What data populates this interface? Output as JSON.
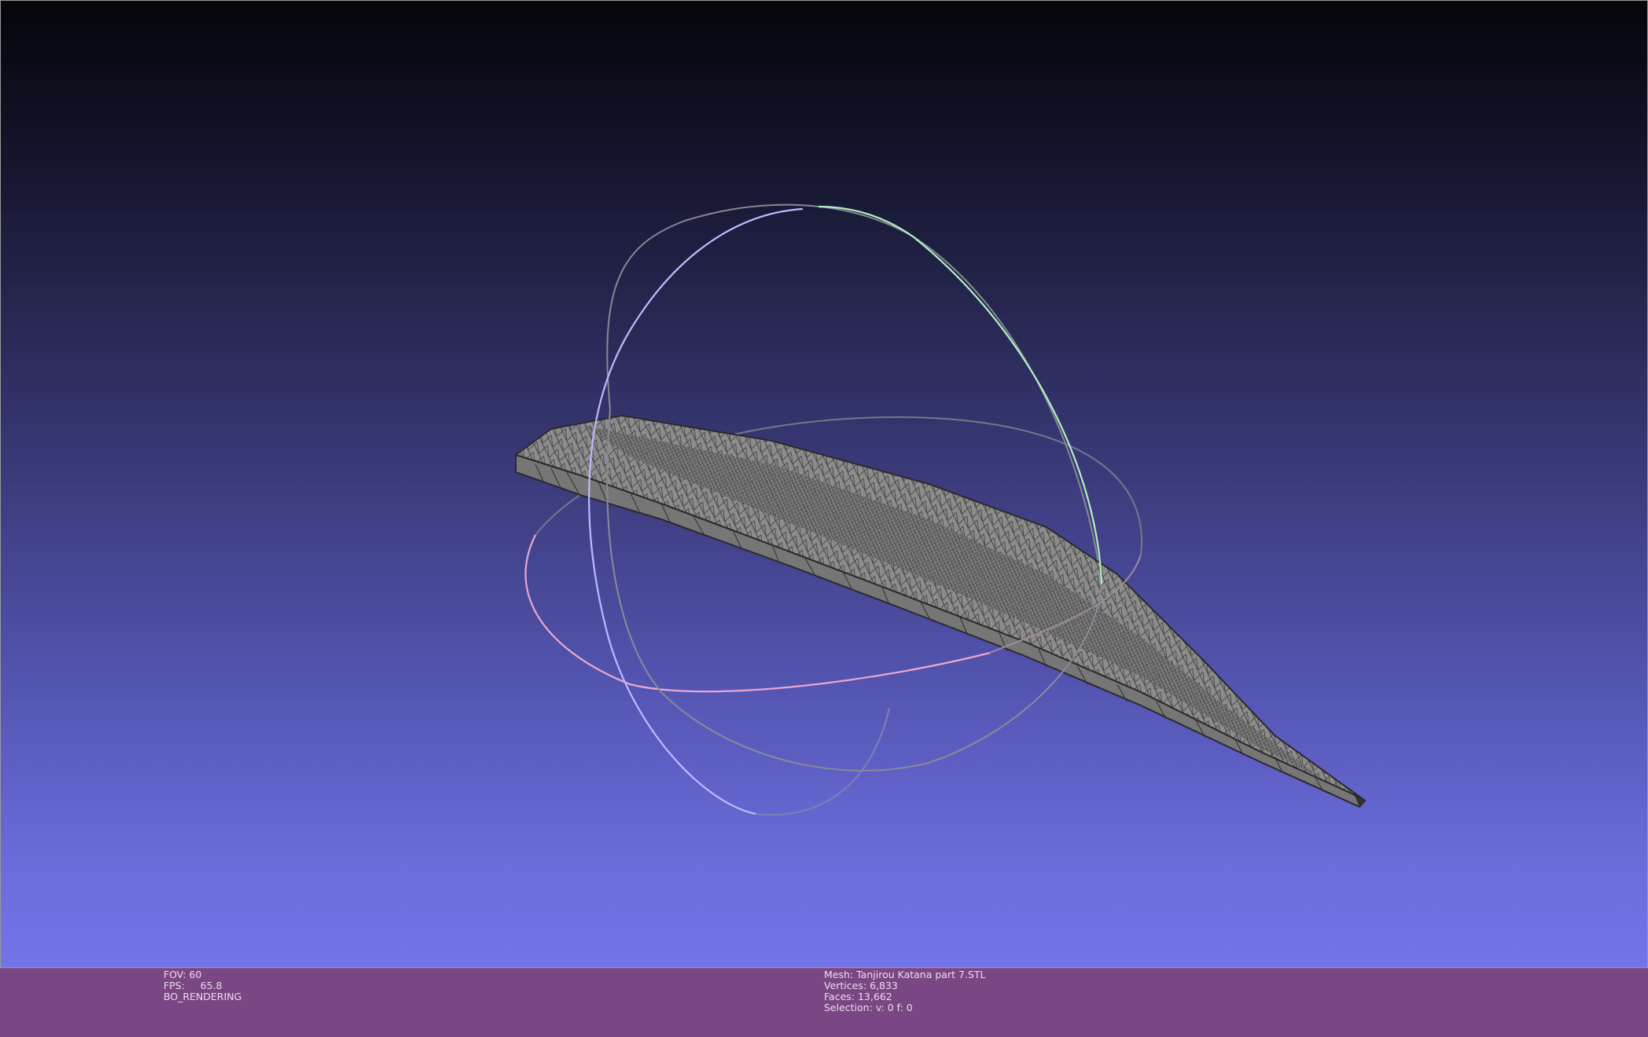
{
  "viewport": {
    "background_top": "#05050a",
    "background_bottom": "#7474ea"
  },
  "trackball": {
    "x_ring_color": "#f0a0c8",
    "y_ring_color": "#a0ffc0",
    "z_ring_color": "#b8b0ff"
  },
  "mesh": {
    "fill_color": "#8a8a8a",
    "edge_color": "#2a2a2a"
  },
  "infobar": {
    "background": "#7b4684",
    "fov_label": "FOV:",
    "fov_value": "60",
    "fps_label": "FPS:",
    "fps_value": "65.8",
    "render_mode": "BO_RENDERING",
    "mesh_label": "Mesh:",
    "mesh_name": "Tanjirou Katana part 7.STL",
    "vertices_label": "Vertices:",
    "vertices_value": "6,833",
    "faces_label": "Faces:",
    "faces_value": "13,662",
    "selection_label": "Selection:",
    "selection_value": "v: 0 f: 0"
  }
}
